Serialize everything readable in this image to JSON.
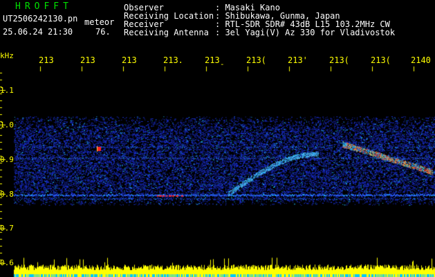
{
  "header": {
    "app_title": "HROFFT",
    "file_name": "UT2506242130.pn",
    "mode": "meteor",
    "datetime": "25.06.24 21:30",
    "count": "76.",
    "fields": [
      {
        "label": "Observer",
        "value": ": Masaki Kano"
      },
      {
        "label": "Receiving Location",
        "value": ": Shibukawa, Gunma, Japan"
      },
      {
        "label": "Receiver",
        "value": ": RTL-SDR SDR# 43dB L15 103.2MHz CW"
      },
      {
        "label": "Receiving Antenna",
        "value": ": 3el Yagi(V) Az 330 for Vladivostok"
      }
    ]
  },
  "time_axis": {
    "labels": [
      "213",
      "213",
      "213",
      "213.",
      "213̠",
      "213(",
      "213'",
      "213(",
      "213(",
      "2140"
    ]
  },
  "freq_axis": {
    "unit": "kHz",
    "labels": [
      "1.1",
      "1.0",
      "0.9",
      "0.8",
      "0.7",
      "0.6"
    ]
  },
  "colors": {
    "background": "#000000",
    "header_text": "#ffffff",
    "title": "#00e000",
    "axis": "#ffff00",
    "signal_low": "#1a2fd0",
    "signal_mid": "#20c0ff",
    "signal_high": "#ff2020"
  }
}
